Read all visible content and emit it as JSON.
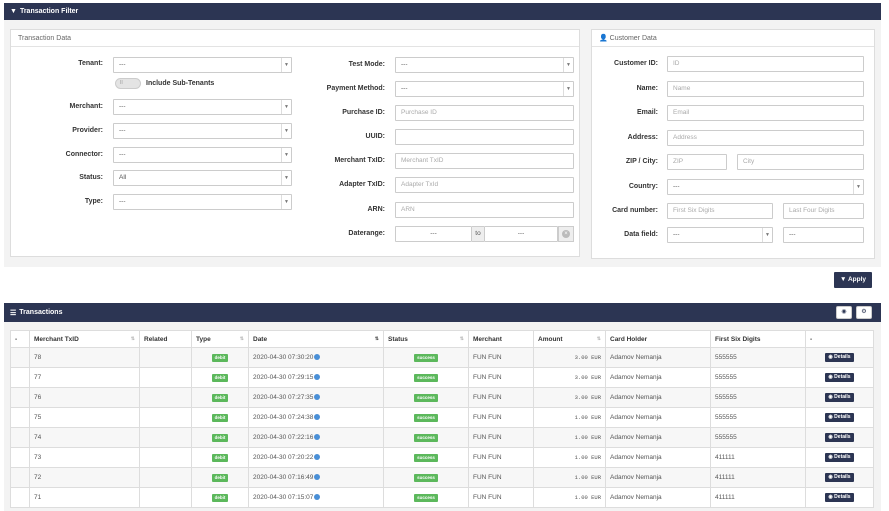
{
  "filter": {
    "title": "Transaction Filter",
    "transaction_data": {
      "title": "Transaction Data",
      "tenant": {
        "label": "Tenant:",
        "value": "---"
      },
      "include_sub_tenants": {
        "label": "Include Sub-Tenants"
      },
      "merchant": {
        "label": "Merchant:",
        "value": "---"
      },
      "provider": {
        "label": "Provider:",
        "value": "---"
      },
      "connector": {
        "label": "Connector:",
        "value": "---"
      },
      "status": {
        "label": "Status:",
        "value": "All"
      },
      "type": {
        "label": "Type:",
        "value": "---"
      },
      "test_mode": {
        "label": "Test Mode:",
        "value": "---"
      },
      "payment_method": {
        "label": "Payment Method:",
        "value": "---"
      },
      "purchase_id": {
        "label": "Purchase ID:",
        "placeholder": "Purchase ID"
      },
      "uuid": {
        "label": "UUID:",
        "value": ""
      },
      "merchant_txid": {
        "label": "Merchant TxID:",
        "placeholder": "Merchant TxID"
      },
      "adapter_txid": {
        "label": "Adapter TxID:",
        "placeholder": "Adapter TxId"
      },
      "arn": {
        "label": "ARN:",
        "placeholder": "ARN"
      },
      "daterange": {
        "label": "Daterange:",
        "from": "---",
        "to_label": "to",
        "to": "---"
      }
    },
    "customer_data": {
      "title": "Customer Data",
      "customer_id": {
        "label": "Customer ID:",
        "placeholder": "ID"
      },
      "name": {
        "label": "Name:",
        "placeholder": "Name"
      },
      "email": {
        "label": "Email:",
        "placeholder": "Email"
      },
      "address": {
        "label": "Address:",
        "placeholder": "Address"
      },
      "zip_city": {
        "label": "ZIP / City:",
        "zip_placeholder": "ZIP",
        "city_placeholder": "City"
      },
      "country": {
        "label": "Country:",
        "value": "---"
      },
      "card_number": {
        "label": "Card number:",
        "first_placeholder": "First Six Digits",
        "last_placeholder": "Last Four Digits"
      },
      "data_field": {
        "label": "Data field:",
        "value": "---",
        "second_value": "---"
      }
    },
    "apply_label": "Apply"
  },
  "transactions": {
    "title": "Transactions",
    "columns": [
      "-",
      "Merchant TxID",
      "Related",
      "Type",
      "Date",
      "Status",
      "Merchant",
      "Amount",
      "Card Holder",
      "First Six Digits",
      "-"
    ],
    "rows": [
      {
        "txid": "78",
        "related": "",
        "type": "debit",
        "date": "2020-04-30 07:30:20",
        "status": "success",
        "merchant": "FUN FUN",
        "amount": "3.00 EUR",
        "holder": "Adamov Nemanja",
        "first_six": "555555",
        "action": "Details"
      },
      {
        "txid": "77",
        "related": "",
        "type": "debit",
        "date": "2020-04-30 07:29:15",
        "status": "success",
        "merchant": "FUN FUN",
        "amount": "3.00 EUR",
        "holder": "Adamov Nemanja",
        "first_six": "555555",
        "action": "Details"
      },
      {
        "txid": "76",
        "related": "",
        "type": "debit",
        "date": "2020-04-30 07:27:35",
        "status": "success",
        "merchant": "FUN FUN",
        "amount": "3.00 EUR",
        "holder": "Adamov Nemanja",
        "first_six": "555555",
        "action": "Details"
      },
      {
        "txid": "75",
        "related": "",
        "type": "debit",
        "date": "2020-04-30 07:24:38",
        "status": "success",
        "merchant": "FUN FUN",
        "amount": "1.00 EUR",
        "holder": "Adamov Nemanja",
        "first_six": "555555",
        "action": "Details"
      },
      {
        "txid": "74",
        "related": "",
        "type": "debit",
        "date": "2020-04-30 07:22:16",
        "status": "success",
        "merchant": "FUN FUN",
        "amount": "1.00 EUR",
        "holder": "Adamov Nemanja",
        "first_six": "555555",
        "action": "Details"
      },
      {
        "txid": "73",
        "related": "",
        "type": "debit",
        "date": "2020-04-30 07:20:22",
        "status": "success",
        "merchant": "FUN FUN",
        "amount": "1.00 EUR",
        "holder": "Adamov Nemanja",
        "first_six": "411111",
        "action": "Details"
      },
      {
        "txid": "72",
        "related": "",
        "type": "debit",
        "date": "2020-04-30 07:16:49",
        "status": "success",
        "merchant": "FUN FUN",
        "amount": "1.00 EUR",
        "holder": "Adamov Nemanja",
        "first_six": "411111",
        "action": "Details"
      },
      {
        "txid": "71",
        "related": "",
        "type": "debit",
        "date": "2020-04-30 07:15:07",
        "status": "success",
        "merchant": "FUN FUN",
        "amount": "1.00 EUR",
        "holder": "Adamov Nemanja",
        "first_six": "411111",
        "action": "Details"
      }
    ]
  },
  "icons": {
    "filter": "filter-icon",
    "user": "user-icon",
    "list": "list-icon",
    "eye": "eye-icon",
    "cogs": "cogs-icon",
    "globe": "globe-icon",
    "sort": "sort-icon"
  },
  "colors": {
    "navbar": "#2c3553",
    "success": "#5cb85c",
    "globe": "#4a8fd6"
  }
}
